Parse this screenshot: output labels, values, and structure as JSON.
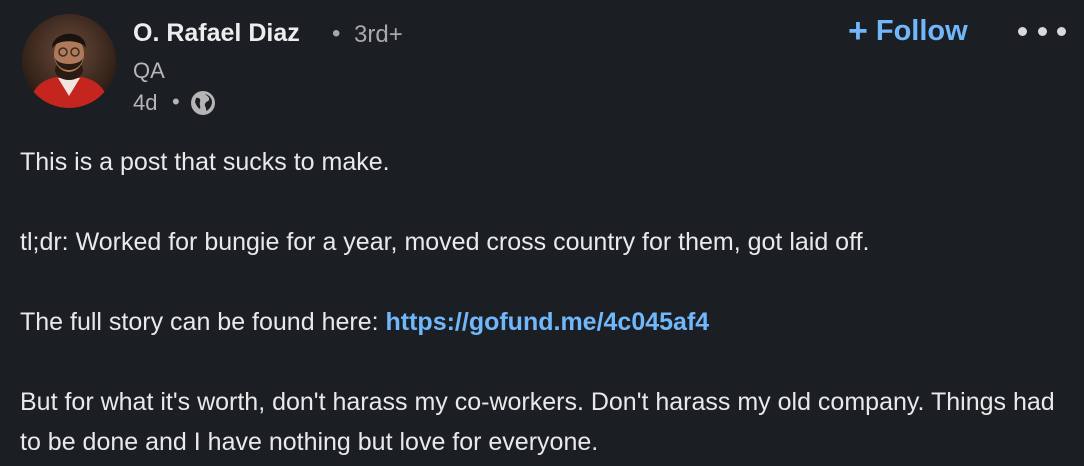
{
  "post": {
    "author": {
      "name": "O. Rafael Diaz",
      "degree": "3rd+",
      "headline": "QA",
      "time": "4d"
    },
    "separator": "•",
    "actions": {
      "follow_plus": "+",
      "follow_label": "Follow",
      "more_icon": "ellipsis-icon",
      "visibility_icon": "globe-icon"
    },
    "body": {
      "line1": "This is a post that sucks to make.",
      "line2": "tl;dr: Worked for bungie for a year, moved cross country for them, got laid off.",
      "line3_prefix": "The full story can be found here: ",
      "line3_link": "https://gofund.me/4c045af4",
      "line4": "But for what it's worth, don't harass my co-workers. Don't harass my old company. Things had to be done and I have nothing but love for everyone."
    }
  },
  "colors": {
    "background": "#1b1f23",
    "link": "#71b7fb",
    "text": "#e9e9e9",
    "muted": "#a8a8a8"
  }
}
